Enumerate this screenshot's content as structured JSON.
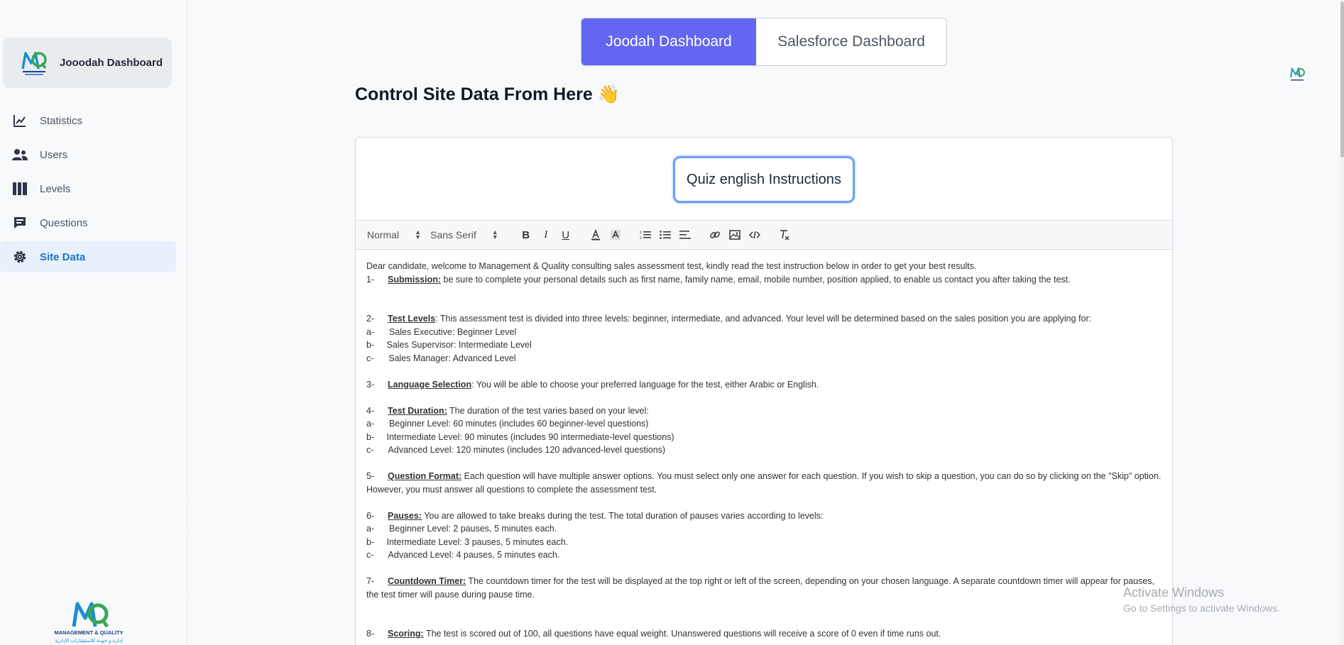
{
  "sidebar": {
    "brand_title": "Jooodah Dashboard",
    "items": [
      {
        "label": "Statistics",
        "icon": "chart-line-icon"
      },
      {
        "label": "Users",
        "icon": "users-icon"
      },
      {
        "label": "Levels",
        "icon": "columns-icon"
      },
      {
        "label": "Questions",
        "icon": "comment-icon"
      },
      {
        "label": "Site Data",
        "icon": "gear-icon",
        "active": true
      }
    ],
    "bottom_logo": {
      "brand": "MANAGEMENT & QUALITY",
      "arabic": "إدارة و جودة للاستشارات الإدارية"
    }
  },
  "header": {
    "tab_active": "Joodah Dashboard",
    "tab_inactive": "Salesforce Dashboard"
  },
  "page": {
    "title": "Control Site Data From Here 👋"
  },
  "editor": {
    "section_select": "Quiz english Instructions",
    "toolbar": {
      "format": "Normal",
      "font": "Sans Serif"
    },
    "intro": "Dear candidate, welcome to Management & Quality consulting sales assessment test, kindly read the test instruction below in order to get your best results.",
    "s1_num": "1-",
    "s1_title": "Submission:",
    "s1_text": " be sure to complete your personal details such as first name, family name, email, mobile number, position applied, to enable us contact you after taking the test.",
    "s2_num": "2-",
    "s2_title": "Test Levels",
    "s2_text": ": This assessment test is divided into three levels: beginner, intermediate, and advanced. Your level will be determined based on the sales position you are applying for:",
    "s2_a": "a-      Sales Executive: Beginner Level",
    "s2_b": "b-     Sales Supervisor: Intermediate Level",
    "s2_c": "c-      Sales Manager: Advanced Level",
    "s3_num": "3-",
    "s3_title": "Language Selection",
    "s3_text": ": You will be able to choose your preferred language for the test, either Arabic or English.",
    "s4_num": "4-",
    "s4_title": "Test Duration:",
    "s4_text": " The duration of the test varies based on your level:",
    "s4_a": "a-      Beginner Level: 60 minutes (includes 60 beginner-level questions)",
    "s4_b": "b-     Intermediate Level: 90 minutes (includes 90 intermediate-level questions)",
    "s4_c": "c-      Advanced Level: 120 minutes (includes 120 advanced-level questions)",
    "s5_num": "5-",
    "s5_title": "Question Format:",
    "s5_text": " Each question will have multiple answer options. You must select only one answer for each question. If you wish to skip a question, you can do so by clicking on the \"Skip\" option. However, you must answer all questions to complete the assessment test.",
    "s6_num": "6-",
    "s6_title": "Pauses:",
    "s6_text": " You are allowed to take breaks during the test. The total duration of pauses varies according to levels:",
    "s6_a": "a-      Beginner Level: 2 pauses, 5 minutes each.",
    "s6_b": "b-     Intermediate Level: 3 pauses, 5 minutes each.",
    "s6_c": "c-      Advanced Level: 4 pauses, 5 minutes each.",
    "s7_num": "7-",
    "s7_title": "Countdown Timer:",
    "s7_text": " The countdown timer for the test will be displayed at the top right or left of the screen, depending on your chosen language. A separate countdown timer will appear for pauses, the test timer will pause during pause time.",
    "s8_num": "8-",
    "s8_title": "Scoring:",
    "s8_text": " The test is scored out of 100, all questions have equal weight. Unanswered questions will receive a score of 0 even if time runs out."
  },
  "watermark": {
    "line1": "Activate Windows",
    "line2": "Go to Settings to activate Windows."
  },
  "colors": {
    "accent": "#6366f1",
    "active_nav": "#1a73c9",
    "active_nav_bg": "#e7f0fb"
  }
}
